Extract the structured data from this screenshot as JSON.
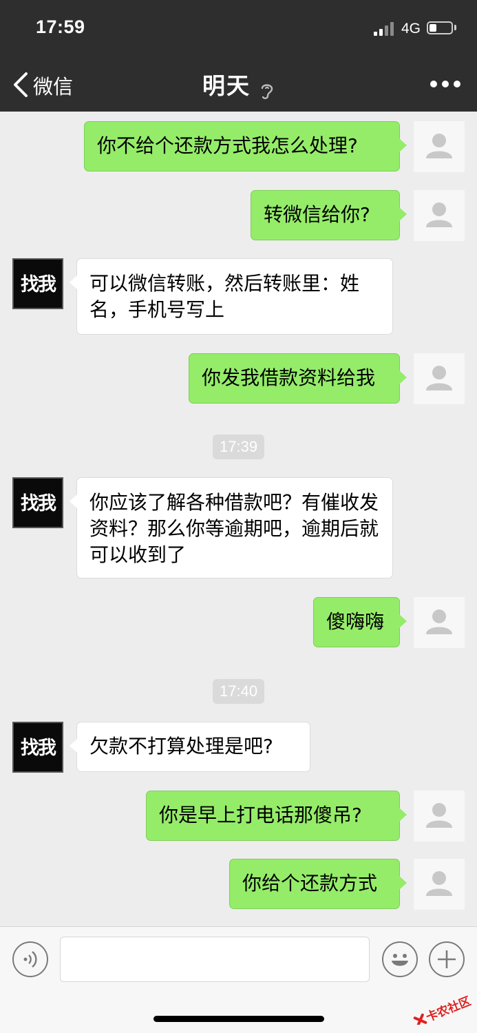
{
  "status_bar": {
    "time": "17:59",
    "network": "4G"
  },
  "nav": {
    "back_label": "微信",
    "title": "明天"
  },
  "avatars": {
    "other_text": "找我"
  },
  "messages": [
    {
      "side": "me",
      "text": "你不给个还款方式我怎么处理?"
    },
    {
      "side": "me",
      "text": "转微信给你?"
    },
    {
      "side": "other",
      "text": "可以微信转账，然后转账里：姓名，手机号写上"
    },
    {
      "side": "me",
      "text": "你发我借款资料给我"
    },
    {
      "side": "time",
      "text": "17:39"
    },
    {
      "side": "other",
      "text": "你应该了解各种借款吧？有催收发资料？那么你等逾期吧，逾期后就可以收到了"
    },
    {
      "side": "me",
      "text": "傻嗨嗨"
    },
    {
      "side": "time",
      "text": "17:40"
    },
    {
      "side": "other",
      "text": "欠款不打算处理是吧?"
    },
    {
      "side": "me",
      "text": "你是早上打电话那傻吊?"
    },
    {
      "side": "me",
      "text": "你给个还款方式"
    }
  ],
  "input": {
    "placeholder": ""
  },
  "watermark": {
    "text": "卡农社区"
  },
  "colors": {
    "nav_bg": "#2e2e2e",
    "chat_bg": "#ededed",
    "my_bubble": "#95ec69",
    "other_bubble": "#ffffff"
  },
  "icons": [
    "back-chevron-icon",
    "ear-icon",
    "more-icon",
    "voice-icon",
    "emoji-icon",
    "plus-icon",
    "default-avatar-icon"
  ]
}
